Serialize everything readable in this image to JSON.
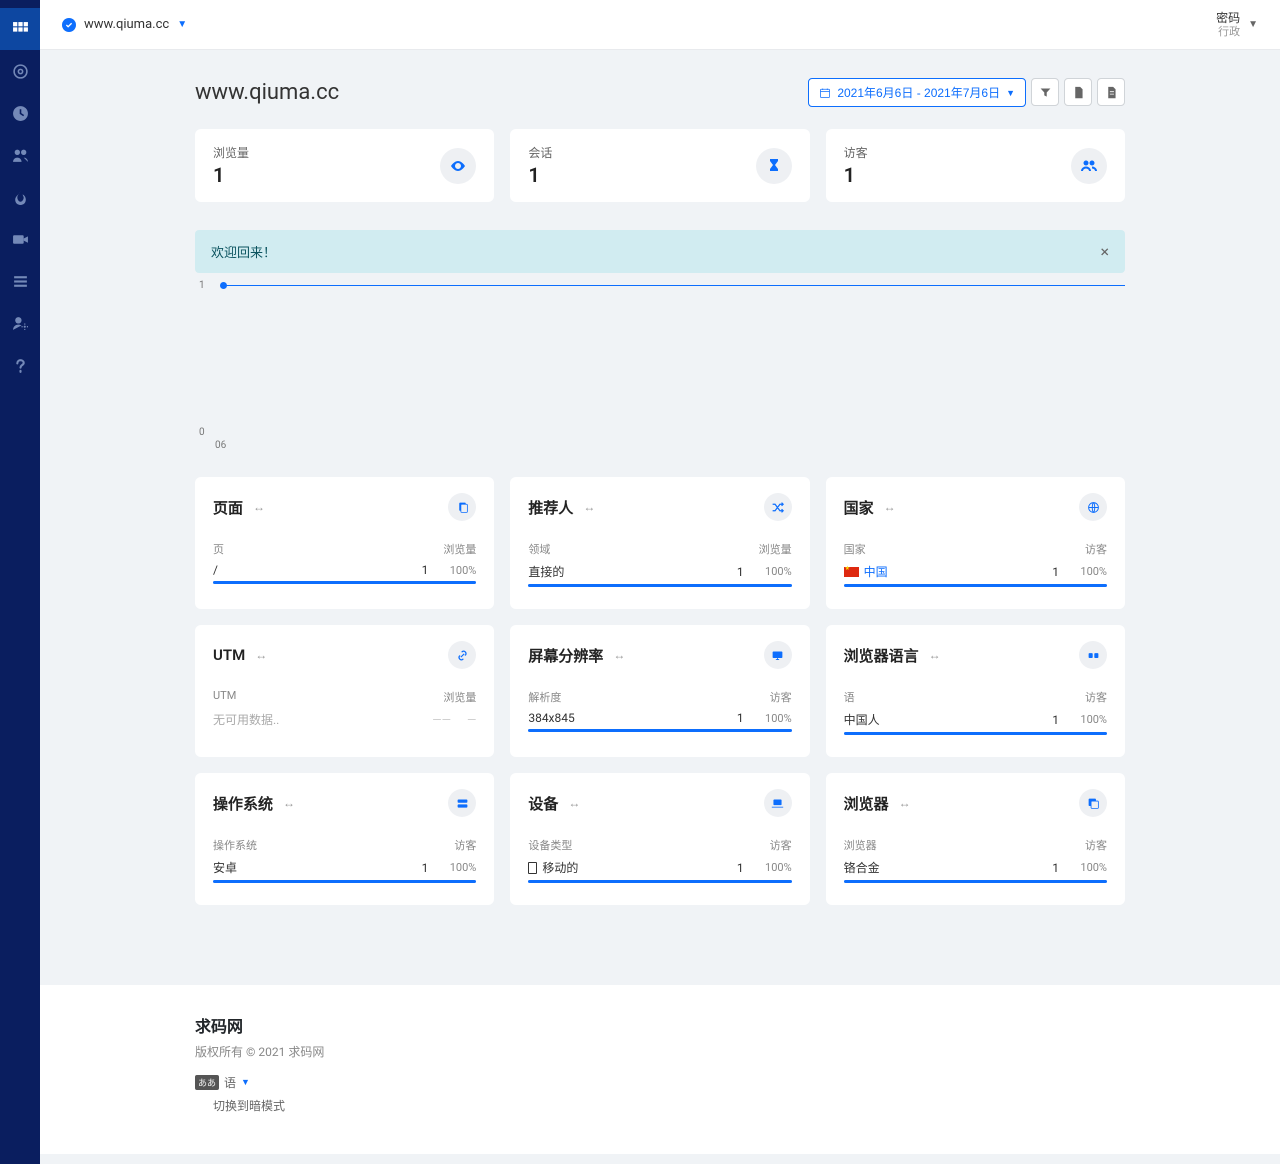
{
  "topbar": {
    "site": "www.qiuma.cc",
    "user_name": "密码",
    "user_role": "行政"
  },
  "page_title": "www.qiuma.cc",
  "date_range": "2021年6月6日 - 2021年7月6日",
  "stats": {
    "pageviews": {
      "label": "浏览量",
      "value": "1"
    },
    "sessions": {
      "label": "会话",
      "value": "1"
    },
    "visitors": {
      "label": "访客",
      "value": "1"
    }
  },
  "alert_text": "欢迎回来！",
  "chart_data": {
    "type": "line",
    "x": [
      "06"
    ],
    "series": [
      {
        "name": "浏览量",
        "values": [
          1
        ]
      }
    ],
    "ylim": [
      0,
      1
    ],
    "xlabel": "",
    "ylabel": ""
  },
  "cards": {
    "pages": {
      "title": "页面",
      "col1": "页",
      "col2": "浏览量",
      "row": {
        "name": "/",
        "value": "1",
        "pct": "100%"
      }
    },
    "referrers": {
      "title": "推荐人",
      "col1": "领域",
      "col2": "浏览量",
      "row": {
        "name": "直接的",
        "value": "1",
        "pct": "100%"
      }
    },
    "countries": {
      "title": "国家",
      "col1": "国家",
      "col2": "访客",
      "row": {
        "name": "中国",
        "value": "1",
        "pct": "100%"
      }
    },
    "utm": {
      "title": "UTM",
      "col1": "UTM",
      "col2": "浏览量",
      "empty": "无可用数据.."
    },
    "screens": {
      "title": "屏幕分辨率",
      "col1": "解析度",
      "col2": "访客",
      "row": {
        "name": "384x845",
        "value": "1",
        "pct": "100%"
      }
    },
    "languages": {
      "title": "浏览器语言",
      "col1": "语",
      "col2": "访客",
      "row": {
        "name": "中国人",
        "value": "1",
        "pct": "100%"
      }
    },
    "os": {
      "title": "操作系统",
      "col1": "操作系统",
      "col2": "访客",
      "row": {
        "name": "安卓",
        "value": "1",
        "pct": "100%"
      }
    },
    "devices": {
      "title": "设备",
      "col1": "设备类型",
      "col2": "访客",
      "row": {
        "name": "移动的",
        "value": "1",
        "pct": "100%"
      }
    },
    "browsers": {
      "title": "浏览器",
      "col1": "浏览器",
      "col2": "访客",
      "row": {
        "name": "铬合金",
        "value": "1",
        "pct": "100%"
      }
    }
  },
  "footer": {
    "brand": "求码网",
    "copyright": "版权所有 © 2021 求码网",
    "lang_label": "语",
    "theme_label": "切换到暗模式"
  }
}
